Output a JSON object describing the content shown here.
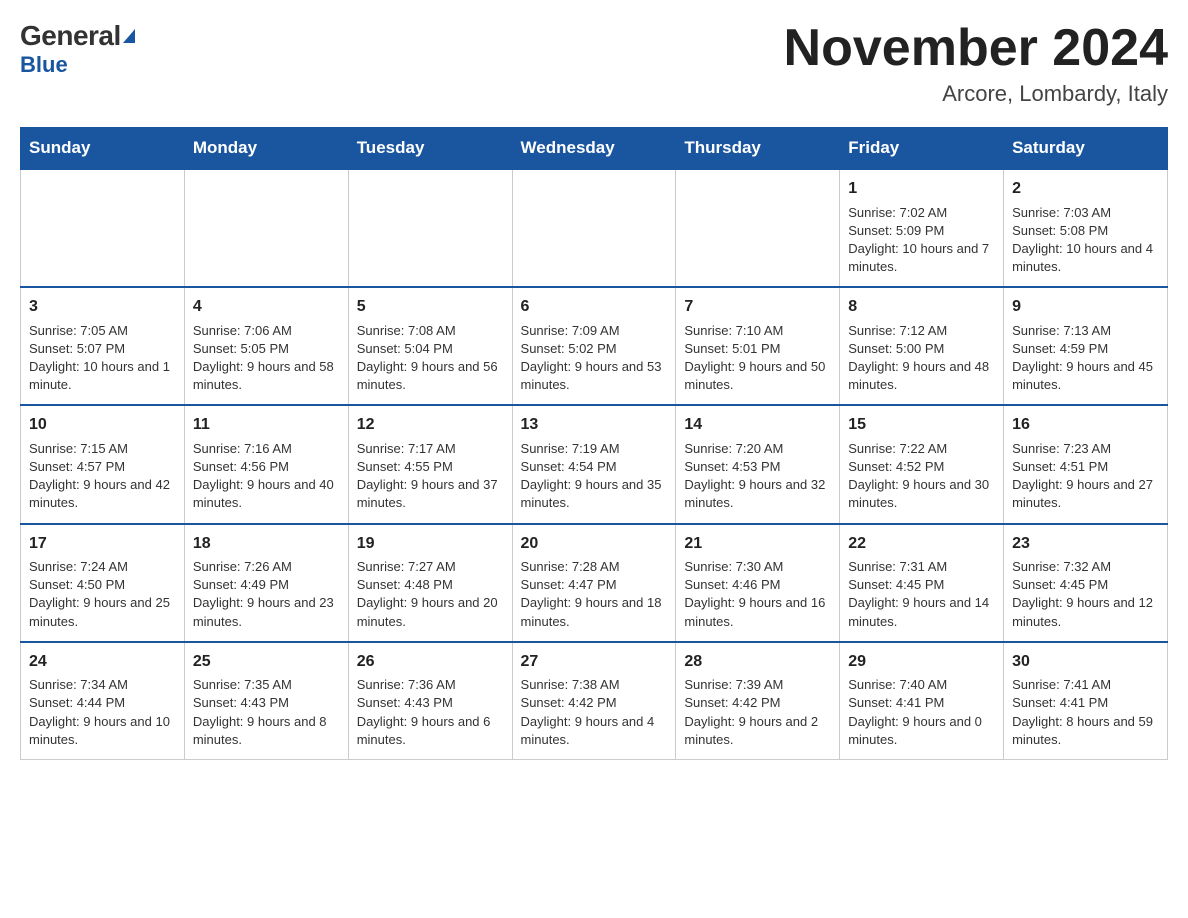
{
  "logo": {
    "general": "General",
    "blue": "Blue"
  },
  "title": "November 2024",
  "location": "Arcore, Lombardy, Italy",
  "days_of_week": [
    "Sunday",
    "Monday",
    "Tuesday",
    "Wednesday",
    "Thursday",
    "Friday",
    "Saturday"
  ],
  "weeks": [
    [
      {
        "day": "",
        "sunrise": "",
        "sunset": "",
        "daylight": ""
      },
      {
        "day": "",
        "sunrise": "",
        "sunset": "",
        "daylight": ""
      },
      {
        "day": "",
        "sunrise": "",
        "sunset": "",
        "daylight": ""
      },
      {
        "day": "",
        "sunrise": "",
        "sunset": "",
        "daylight": ""
      },
      {
        "day": "",
        "sunrise": "",
        "sunset": "",
        "daylight": ""
      },
      {
        "day": "1",
        "sunrise": "Sunrise: 7:02 AM",
        "sunset": "Sunset: 5:09 PM",
        "daylight": "Daylight: 10 hours and 7 minutes."
      },
      {
        "day": "2",
        "sunrise": "Sunrise: 7:03 AM",
        "sunset": "Sunset: 5:08 PM",
        "daylight": "Daylight: 10 hours and 4 minutes."
      }
    ],
    [
      {
        "day": "3",
        "sunrise": "Sunrise: 7:05 AM",
        "sunset": "Sunset: 5:07 PM",
        "daylight": "Daylight: 10 hours and 1 minute."
      },
      {
        "day": "4",
        "sunrise": "Sunrise: 7:06 AM",
        "sunset": "Sunset: 5:05 PM",
        "daylight": "Daylight: 9 hours and 58 minutes."
      },
      {
        "day": "5",
        "sunrise": "Sunrise: 7:08 AM",
        "sunset": "Sunset: 5:04 PM",
        "daylight": "Daylight: 9 hours and 56 minutes."
      },
      {
        "day": "6",
        "sunrise": "Sunrise: 7:09 AM",
        "sunset": "Sunset: 5:02 PM",
        "daylight": "Daylight: 9 hours and 53 minutes."
      },
      {
        "day": "7",
        "sunrise": "Sunrise: 7:10 AM",
        "sunset": "Sunset: 5:01 PM",
        "daylight": "Daylight: 9 hours and 50 minutes."
      },
      {
        "day": "8",
        "sunrise": "Sunrise: 7:12 AM",
        "sunset": "Sunset: 5:00 PM",
        "daylight": "Daylight: 9 hours and 48 minutes."
      },
      {
        "day": "9",
        "sunrise": "Sunrise: 7:13 AM",
        "sunset": "Sunset: 4:59 PM",
        "daylight": "Daylight: 9 hours and 45 minutes."
      }
    ],
    [
      {
        "day": "10",
        "sunrise": "Sunrise: 7:15 AM",
        "sunset": "Sunset: 4:57 PM",
        "daylight": "Daylight: 9 hours and 42 minutes."
      },
      {
        "day": "11",
        "sunrise": "Sunrise: 7:16 AM",
        "sunset": "Sunset: 4:56 PM",
        "daylight": "Daylight: 9 hours and 40 minutes."
      },
      {
        "day": "12",
        "sunrise": "Sunrise: 7:17 AM",
        "sunset": "Sunset: 4:55 PM",
        "daylight": "Daylight: 9 hours and 37 minutes."
      },
      {
        "day": "13",
        "sunrise": "Sunrise: 7:19 AM",
        "sunset": "Sunset: 4:54 PM",
        "daylight": "Daylight: 9 hours and 35 minutes."
      },
      {
        "day": "14",
        "sunrise": "Sunrise: 7:20 AM",
        "sunset": "Sunset: 4:53 PM",
        "daylight": "Daylight: 9 hours and 32 minutes."
      },
      {
        "day": "15",
        "sunrise": "Sunrise: 7:22 AM",
        "sunset": "Sunset: 4:52 PM",
        "daylight": "Daylight: 9 hours and 30 minutes."
      },
      {
        "day": "16",
        "sunrise": "Sunrise: 7:23 AM",
        "sunset": "Sunset: 4:51 PM",
        "daylight": "Daylight: 9 hours and 27 minutes."
      }
    ],
    [
      {
        "day": "17",
        "sunrise": "Sunrise: 7:24 AM",
        "sunset": "Sunset: 4:50 PM",
        "daylight": "Daylight: 9 hours and 25 minutes."
      },
      {
        "day": "18",
        "sunrise": "Sunrise: 7:26 AM",
        "sunset": "Sunset: 4:49 PM",
        "daylight": "Daylight: 9 hours and 23 minutes."
      },
      {
        "day": "19",
        "sunrise": "Sunrise: 7:27 AM",
        "sunset": "Sunset: 4:48 PM",
        "daylight": "Daylight: 9 hours and 20 minutes."
      },
      {
        "day": "20",
        "sunrise": "Sunrise: 7:28 AM",
        "sunset": "Sunset: 4:47 PM",
        "daylight": "Daylight: 9 hours and 18 minutes."
      },
      {
        "day": "21",
        "sunrise": "Sunrise: 7:30 AM",
        "sunset": "Sunset: 4:46 PM",
        "daylight": "Daylight: 9 hours and 16 minutes."
      },
      {
        "day": "22",
        "sunrise": "Sunrise: 7:31 AM",
        "sunset": "Sunset: 4:45 PM",
        "daylight": "Daylight: 9 hours and 14 minutes."
      },
      {
        "day": "23",
        "sunrise": "Sunrise: 7:32 AM",
        "sunset": "Sunset: 4:45 PM",
        "daylight": "Daylight: 9 hours and 12 minutes."
      }
    ],
    [
      {
        "day": "24",
        "sunrise": "Sunrise: 7:34 AM",
        "sunset": "Sunset: 4:44 PM",
        "daylight": "Daylight: 9 hours and 10 minutes."
      },
      {
        "day": "25",
        "sunrise": "Sunrise: 7:35 AM",
        "sunset": "Sunset: 4:43 PM",
        "daylight": "Daylight: 9 hours and 8 minutes."
      },
      {
        "day": "26",
        "sunrise": "Sunrise: 7:36 AM",
        "sunset": "Sunset: 4:43 PM",
        "daylight": "Daylight: 9 hours and 6 minutes."
      },
      {
        "day": "27",
        "sunrise": "Sunrise: 7:38 AM",
        "sunset": "Sunset: 4:42 PM",
        "daylight": "Daylight: 9 hours and 4 minutes."
      },
      {
        "day": "28",
        "sunrise": "Sunrise: 7:39 AM",
        "sunset": "Sunset: 4:42 PM",
        "daylight": "Daylight: 9 hours and 2 minutes."
      },
      {
        "day": "29",
        "sunrise": "Sunrise: 7:40 AM",
        "sunset": "Sunset: 4:41 PM",
        "daylight": "Daylight: 9 hours and 0 minutes."
      },
      {
        "day": "30",
        "sunrise": "Sunrise: 7:41 AM",
        "sunset": "Sunset: 4:41 PM",
        "daylight": "Daylight: 8 hours and 59 minutes."
      }
    ]
  ]
}
